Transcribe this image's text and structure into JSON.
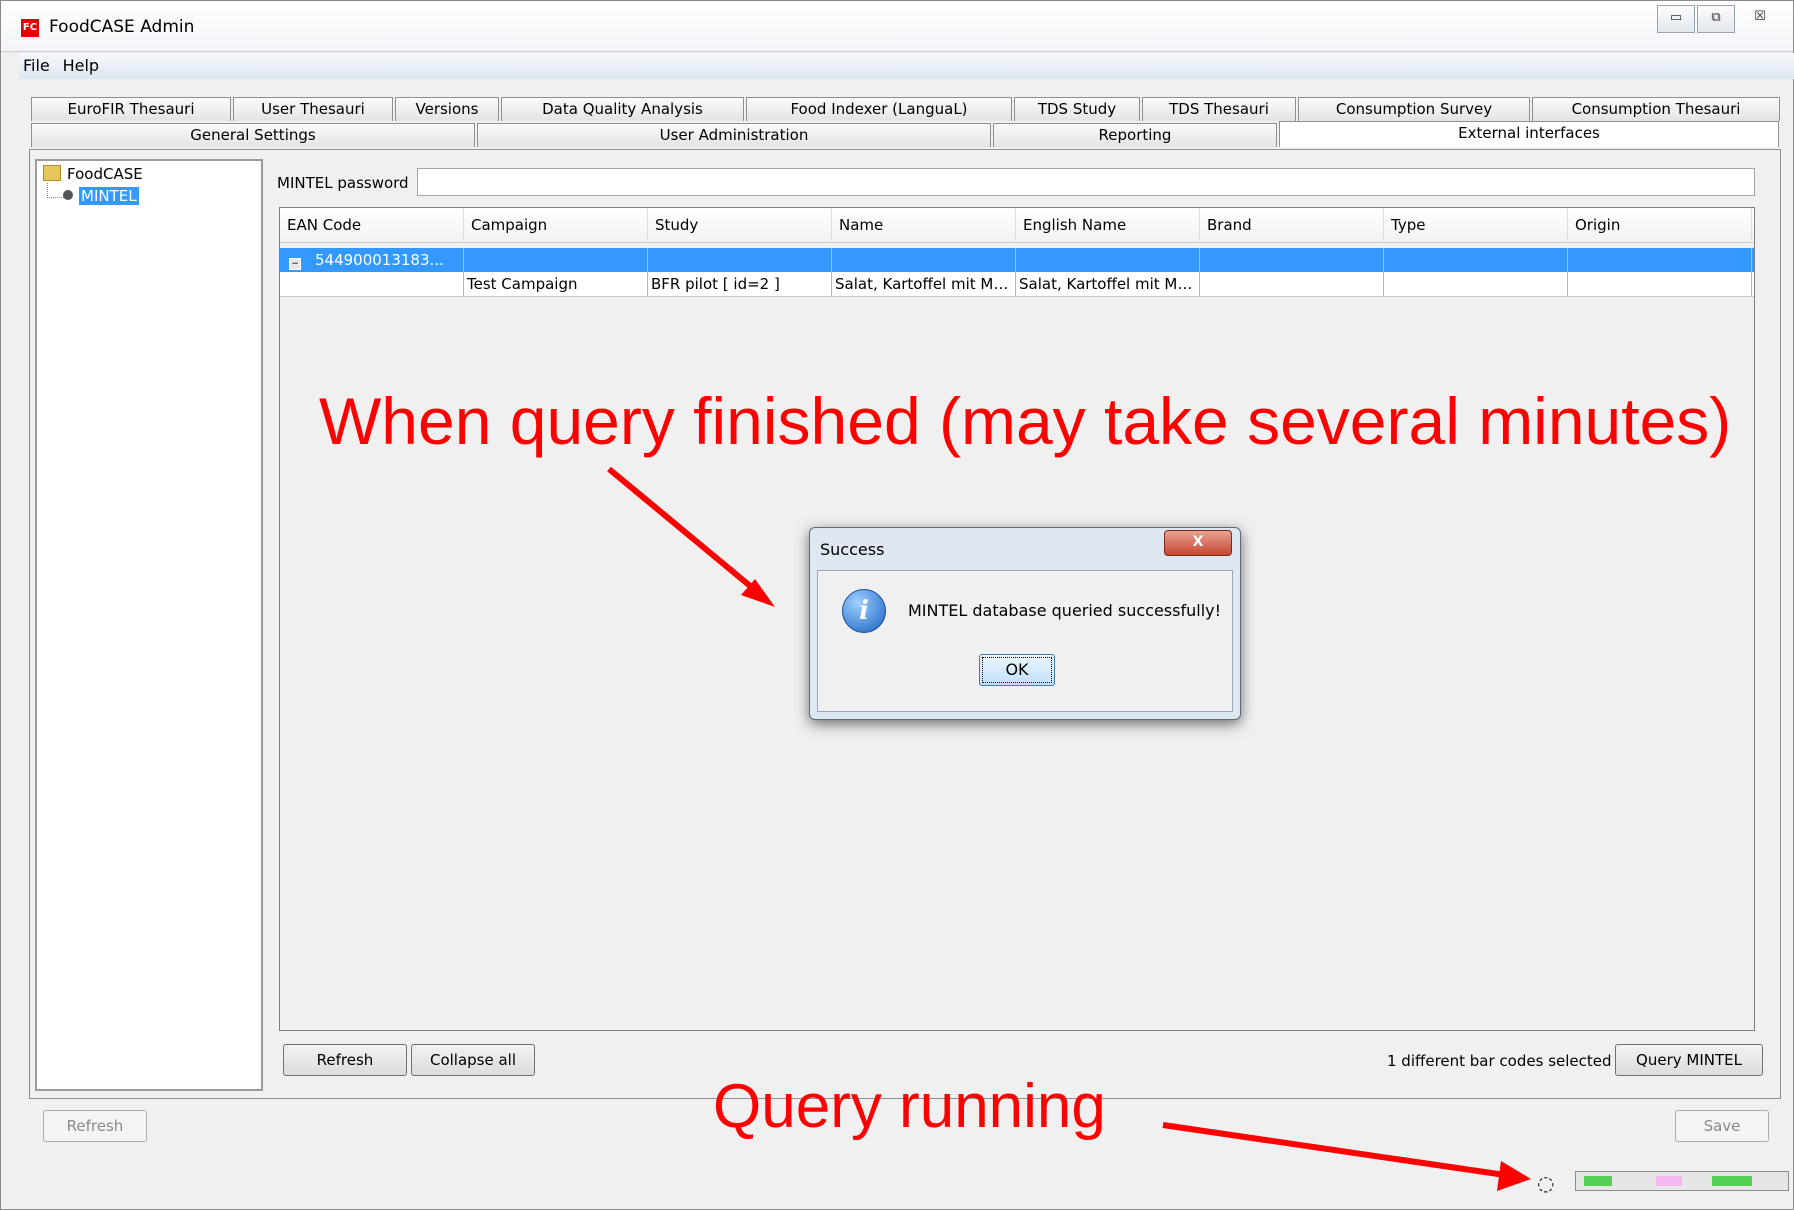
{
  "window": {
    "title": "FoodCASE Admin",
    "icon_text": "FC"
  },
  "window_controls": {
    "minimize": "▭",
    "maximize": "⧉",
    "close": "☒"
  },
  "menu": [
    "File",
    "Help"
  ],
  "tabs_top": [
    "EuroFIR Thesauri",
    "User Thesauri",
    "Versions",
    "Data Quality Analysis",
    "Food Indexer (LanguaL)",
    "TDS Study",
    "TDS Thesauri",
    "Consumption Survey",
    "Consumption Thesauri"
  ],
  "tabs_bottom": [
    "General Settings",
    "User Administration",
    "Reporting",
    "External interfaces"
  ],
  "tree": {
    "root": "FoodCASE",
    "child": "MINTEL"
  },
  "password_label": "MINTEL password",
  "table": {
    "columns": [
      "EAN Code",
      "Campaign",
      "Study",
      "Name",
      "English Name",
      "Brand",
      "Type",
      "Origin"
    ],
    "rows": [
      [
        "544900013183...",
        "",
        "",
        "",
        "",
        "",
        "",
        ""
      ],
      [
        "",
        "Test Campaign",
        "BFR pilot [ id=2 ]",
        "Salat, Kartoffel mit Ma...",
        "Salat, Kartoffel mit Ma...",
        "",
        "",
        ""
      ]
    ]
  },
  "buttons": {
    "refresh": "Refresh",
    "collapse_all": "Collapse all",
    "query_mintel": "Query MINTEL",
    "outer_refresh": "Refresh",
    "save": "Save"
  },
  "status_text": "1 different bar codes selected",
  "dialog": {
    "title": "Success",
    "close_glyph": "X",
    "message": "MINTEL database queried successfully!",
    "ok": "OK"
  },
  "annotations": {
    "top": "When query finished (may take several minutes)",
    "bottom": "Query running",
    "color": "#ff0000"
  },
  "spinner_glyph": "◌"
}
